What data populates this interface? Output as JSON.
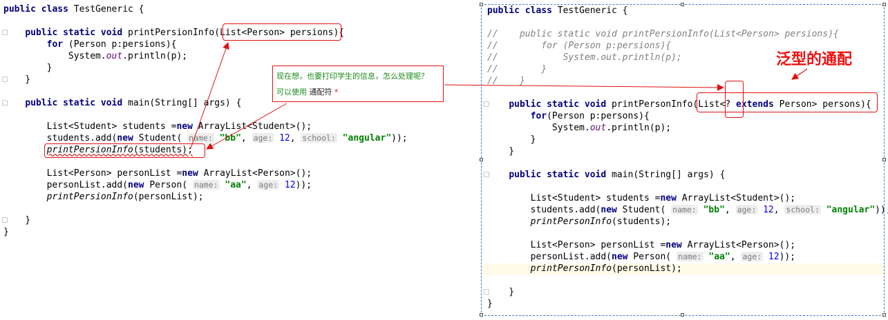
{
  "left": {
    "lines": [
      [
        {
          "t": "pub",
          "c": "kw"
        },
        {
          "t": "lic",
          "c": "kw"
        },
        {
          "t": " "
        },
        {
          "t": "class",
          "c": "kw"
        },
        {
          "t": " TestGeneric {"
        }
      ],
      [],
      [
        {
          "t": "    "
        },
        {
          "t": "public static void",
          "c": "kw"
        },
        {
          "t": " printPersionInfo(List<Person> persions){"
        }
      ],
      [
        {
          "t": "        "
        },
        {
          "t": "for",
          "c": "kw"
        },
        {
          "t": " (Person p:persions){"
        }
      ],
      [
        {
          "t": "            System."
        },
        {
          "t": "out",
          "c": "fld"
        },
        {
          "t": ".println(p);"
        }
      ],
      [
        {
          "t": "        }"
        }
      ],
      [
        {
          "t": "    }"
        }
      ],
      [],
      [
        {
          "t": "    "
        },
        {
          "t": "public static void",
          "c": "kw"
        },
        {
          "t": " main(String[] args) {"
        }
      ],
      [],
      [
        {
          "t": "        List<Student> students ="
        },
        {
          "t": "new",
          "c": "kw"
        },
        {
          "t": " ArrayList<Student>();"
        }
      ],
      [
        {
          "t": "        students.add("
        },
        {
          "t": "new",
          "c": "kw"
        },
        {
          "t": " Student( "
        },
        {
          "t": "name:",
          "c": "hint"
        },
        {
          "t": " "
        },
        {
          "t": "\"bb\"",
          "c": "str"
        },
        {
          "t": ", "
        },
        {
          "t": "age:",
          "c": "hint"
        },
        {
          "t": " "
        },
        {
          "t": "12",
          "c": "num"
        },
        {
          "t": ", "
        },
        {
          "t": "school:",
          "c": "hint"
        },
        {
          "t": " "
        },
        {
          "t": "\"angular\"",
          "c": "str"
        },
        {
          "t": "));"
        }
      ],
      [
        {
          "t": "        "
        },
        {
          "t": "printPersionInfo",
          "c": "it squig"
        },
        {
          "t": "(students);",
          "c": "squig"
        }
      ],
      [],
      [
        {
          "t": "        List<Person> personList ="
        },
        {
          "t": "new",
          "c": "kw"
        },
        {
          "t": " ArrayList<Person>();"
        }
      ],
      [
        {
          "t": "        personList.add("
        },
        {
          "t": "new",
          "c": "kw"
        },
        {
          "t": " Person( "
        },
        {
          "t": "name:",
          "c": "hint"
        },
        {
          "t": " "
        },
        {
          "t": "\"aa\"",
          "c": "str"
        },
        {
          "t": ", "
        },
        {
          "t": "age:",
          "c": "hint"
        },
        {
          "t": " "
        },
        {
          "t": "12",
          "c": "num"
        },
        {
          "t": "));"
        }
      ],
      [
        {
          "t": "        "
        },
        {
          "t": "printPersionInfo",
          "c": "it"
        },
        {
          "t": "(personList);"
        }
      ],
      [],
      [
        {
          "t": "    }"
        }
      ],
      [
        {
          "t": "}"
        }
      ]
    ]
  },
  "right": {
    "lines": [
      [
        {
          "t": "public",
          "c": "kw"
        },
        {
          "t": " "
        },
        {
          "t": "class",
          "c": "kw"
        },
        {
          "t": " TestGeneric {"
        }
      ],
      [],
      [
        {
          "t": "//    public static void printPersionInfo(List<Person> persions){",
          "c": "cmt"
        }
      ],
      [
        {
          "t": "//        for (Person p:persions){",
          "c": "cmt"
        }
      ],
      [
        {
          "t": "//            System.out.println(p);",
          "c": "cmt"
        }
      ],
      [
        {
          "t": "//        }",
          "c": "cmt"
        }
      ],
      [
        {
          "t": "//    }",
          "c": "cmt"
        }
      ],
      [],
      [
        {
          "t": "    "
        },
        {
          "t": "public static void",
          "c": "kw"
        },
        {
          "t": " printPersonInfo(List<? "
        },
        {
          "t": "extends",
          "c": "kw"
        },
        {
          "t": " Person> persons){"
        }
      ],
      [
        {
          "t": "        "
        },
        {
          "t": "for",
          "c": "kw"
        },
        {
          "t": "(Person p:persons){"
        }
      ],
      [
        {
          "t": "            System."
        },
        {
          "t": "out",
          "c": "fld"
        },
        {
          "t": ".println(p);"
        }
      ],
      [
        {
          "t": "        }"
        }
      ],
      [
        {
          "t": "    }"
        }
      ],
      [],
      [
        {
          "t": "    "
        },
        {
          "t": "public static void",
          "c": "kw"
        },
        {
          "t": " main(String[] args) {"
        }
      ],
      [],
      [
        {
          "t": "        List<Student> students ="
        },
        {
          "t": "new",
          "c": "kw"
        },
        {
          "t": " ArrayList<Student>();"
        }
      ],
      [
        {
          "t": "        students.add("
        },
        {
          "t": "new",
          "c": "kw"
        },
        {
          "t": " Student( "
        },
        {
          "t": "name:",
          "c": "hint"
        },
        {
          "t": " "
        },
        {
          "t": "\"bb\"",
          "c": "str"
        },
        {
          "t": ", "
        },
        {
          "t": "age:",
          "c": "hint"
        },
        {
          "t": " "
        },
        {
          "t": "12",
          "c": "num"
        },
        {
          "t": ", "
        },
        {
          "t": "school:",
          "c": "hint"
        },
        {
          "t": " "
        },
        {
          "t": "\"angular\"",
          "c": "str"
        },
        {
          "t": "));"
        }
      ],
      [
        {
          "t": "        "
        },
        {
          "t": "printPersonInfo",
          "c": "it"
        },
        {
          "t": "(students);"
        }
      ],
      [],
      [
        {
          "t": "        List<Person> personList ="
        },
        {
          "t": "new",
          "c": "kw"
        },
        {
          "t": " ArrayList<Person>();"
        }
      ],
      [
        {
          "t": "        personList.add("
        },
        {
          "t": "new",
          "c": "kw"
        },
        {
          "t": " Person( "
        },
        {
          "t": "name:",
          "c": "hint"
        },
        {
          "t": " "
        },
        {
          "t": "\"aa\"",
          "c": "str"
        },
        {
          "t": ", "
        },
        {
          "t": "age:",
          "c": "hint"
        },
        {
          "t": " "
        },
        {
          "t": "12",
          "c": "num"
        },
        {
          "t": "));"
        }
      ],
      [
        {
          "t": "        "
        },
        {
          "t": "printPersonInfo",
          "c": "it"
        },
        {
          "t": "(personList);"
        }
      ],
      [],
      [
        {
          "t": "    }"
        }
      ],
      [
        {
          "t": "}"
        }
      ]
    ]
  },
  "note": {
    "line1": "现在想，也要打印学生的信息，怎么处理呢？",
    "line2_prefix": "可以使用",
    "line2_term": "通配符",
    "line2_star": "*"
  },
  "annotation_label": "泛型的通配",
  "colors": {
    "keyword": "#000080",
    "string": "#008000",
    "number": "#0000ff",
    "comment": "#808080",
    "field": "#660e7a",
    "annotation_red": "#e01010",
    "note_text_green": "#1a8a1a"
  }
}
